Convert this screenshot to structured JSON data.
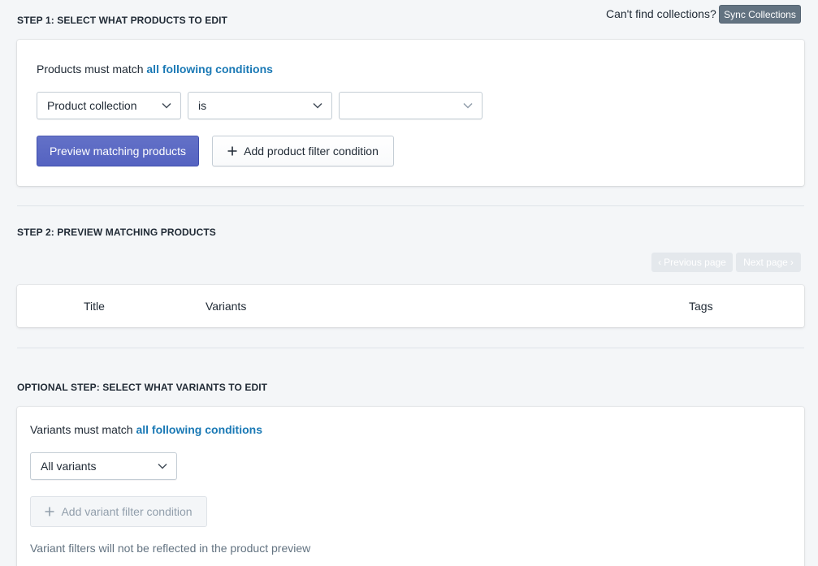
{
  "step1": {
    "title": "STEP 1: SELECT WHAT PRODUCTS TO EDIT",
    "sync_prompt": "Can't find collections?",
    "sync_button": "Sync Collections",
    "condition_prefix": "Products must match",
    "condition_link": "all following conditions",
    "field_select": "Product collection",
    "operator_select": "is",
    "value_select": "",
    "preview_button": "Preview matching products",
    "add_filter_button": "Add product filter condition"
  },
  "step2": {
    "title": "STEP 2: PREVIEW MATCHING PRODUCTS",
    "prev_page": "Previous page",
    "next_page": "Next page",
    "columns": [
      "Title",
      "Variants",
      "Tags"
    ]
  },
  "optional_step": {
    "title": "OPTIONAL STEP: SELECT WHAT VARIANTS TO EDIT",
    "condition_prefix": "Variants must match",
    "condition_link": "all following conditions",
    "variant_select": "All variants",
    "add_filter_button": "Add variant filter condition",
    "note": "Variant filters will not be reflected in the product preview"
  },
  "colors": {
    "primary": "#5c6ac4",
    "link": "#1a79b5",
    "sync_button": "#637381"
  }
}
